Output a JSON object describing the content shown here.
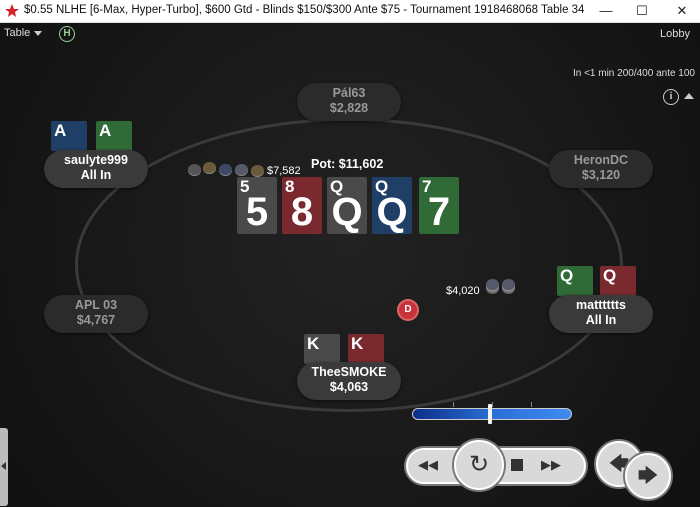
{
  "window": {
    "title": "$0.55 NLHE [6-Max, Hyper-Turbo], $600 Gtd - Blinds $150/$300 Ante $75 - Tournament 1918468068 Table 34",
    "minimize": "—",
    "maximize": "☐",
    "close": "✕"
  },
  "menu": {
    "table": "Table",
    "history_icon": "H",
    "lobby": "Lobby"
  },
  "blinds_next": "In <1 min 200/400 ante 100",
  "info_icon": "i",
  "pot": "Pot: $11,602",
  "board": [
    {
      "rank": "5",
      "color": "black"
    },
    {
      "rank": "8",
      "color": "red"
    },
    {
      "rank": "Q",
      "color": "black"
    },
    {
      "rank": "Q",
      "color": "blue"
    },
    {
      "rank": "7",
      "color": "green"
    }
  ],
  "players": {
    "p1": {
      "name": "Pál63",
      "stack": "$2,828",
      "cards": []
    },
    "p2": {
      "name": "HeronDC",
      "stack": "$3,120",
      "cards": []
    },
    "p3": {
      "name": "matttttts",
      "stack": "All In",
      "cards": [
        {
          "rank": "Q",
          "color": "green"
        },
        {
          "rank": "Q",
          "color": "red"
        }
      ]
    },
    "p4": {
      "name": "TheeSMOKE",
      "stack": "$4,063",
      "cards": [
        {
          "rank": "K",
          "color": "black"
        },
        {
          "rank": "K",
          "color": "red"
        }
      ]
    },
    "p5": {
      "name": "APL 03",
      "stack": "$4,767",
      "cards": []
    },
    "p6": {
      "name": "saulyte999",
      "stack": "All In",
      "cards": [
        {
          "rank": "A",
          "color": "blue"
        },
        {
          "rank": "A",
          "color": "green"
        }
      ]
    }
  },
  "bets": {
    "left": "$7,582",
    "right": "$4,020"
  },
  "dealer_button": "D",
  "bet_slider_level": 0.49,
  "controls": {
    "rewind": "◀◀",
    "replay": "↻",
    "forward": "▶▶",
    "prev_hand": "🡄",
    "next_hand": "🡆"
  },
  "colors": {
    "red": "#7a2a2e",
    "black": "#4a4a4a",
    "blue": "#1f3f66",
    "green": "#2f6a37"
  }
}
